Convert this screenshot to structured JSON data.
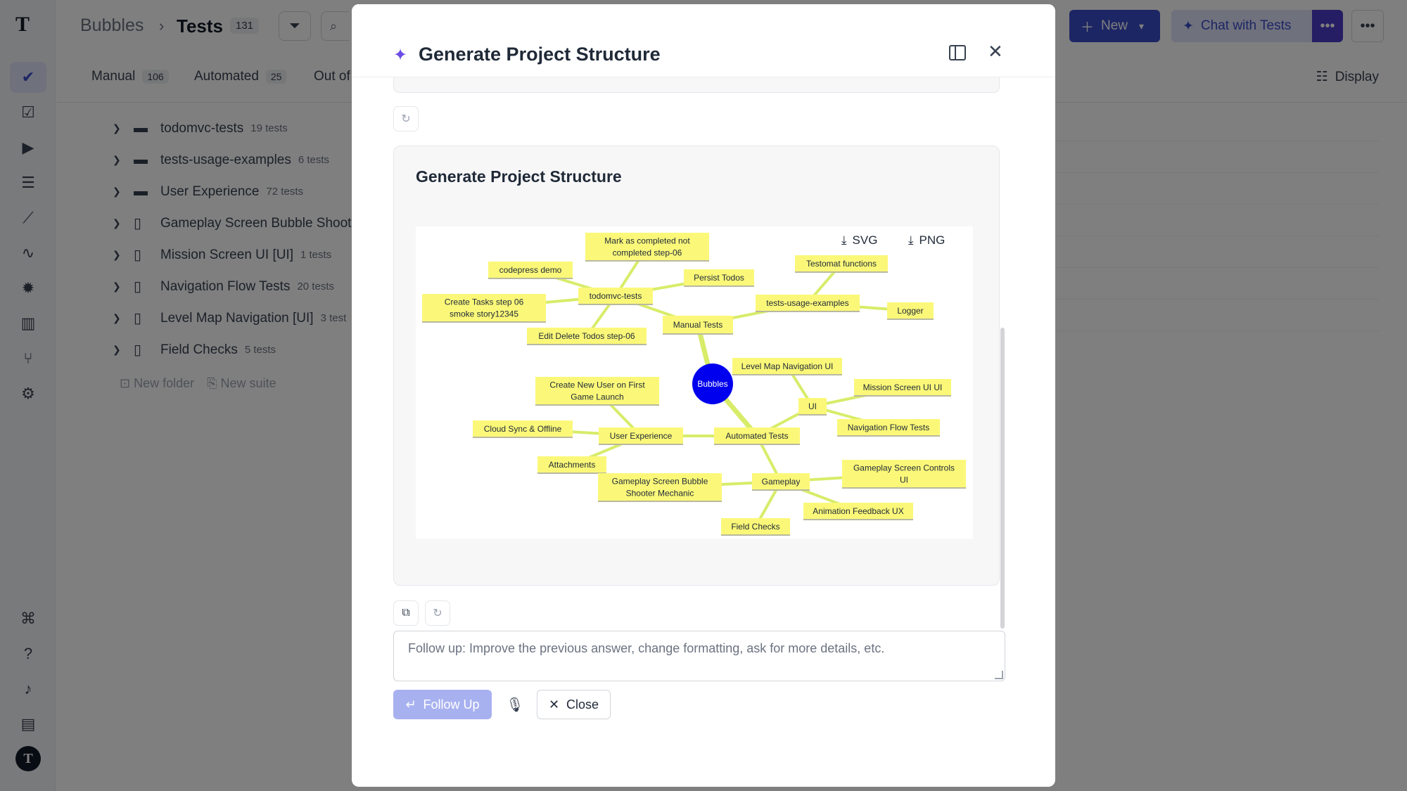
{
  "app": {
    "logo": "T",
    "avatar_letter": "T",
    "breadcrumb": {
      "root": "Bubbles",
      "separator": "›",
      "current": "Tests",
      "count": "131"
    },
    "buttons": {
      "new_label": "New",
      "chat_label": "Chat with Tests",
      "display_label": "Display"
    },
    "tabs": [
      {
        "label": "Manual",
        "count": "106"
      },
      {
        "label": "Automated",
        "count": "25"
      },
      {
        "label": "Out of",
        "count": ""
      }
    ],
    "tree": [
      {
        "name": "todomvc-tests",
        "count": "19 tests",
        "kind": "folder"
      },
      {
        "name": "tests-usage-examples",
        "count": "6 tests",
        "kind": "folder"
      },
      {
        "name": "User Experience",
        "count": "72 tests",
        "kind": "folder"
      },
      {
        "name": "Gameplay Screen Bubble Shoot",
        "count": "",
        "kind": "file"
      },
      {
        "name": "Mission Screen UI [UI]",
        "count": "1 tests",
        "kind": "file"
      },
      {
        "name": "Navigation Flow Tests",
        "count": "20 tests",
        "kind": "file"
      },
      {
        "name": "Level Map Navigation [UI]",
        "count": "3 test",
        "kind": "file"
      },
      {
        "name": "Field Checks",
        "count": "5 tests",
        "kind": "file"
      }
    ],
    "tree_actions": {
      "new_folder": "New folder",
      "new_suite": "New suite"
    }
  },
  "modal": {
    "title": "Generate Project Structure",
    "result_title": "Generate Project Structure",
    "download_svg": "SVG",
    "download_png": "PNG",
    "followup_placeholder": "Follow up: Improve the previous answer, change formatting, ask for more details, etc.",
    "followup_button": "Follow Up",
    "close_button": "Close"
  },
  "mindmap": {
    "root": "Bubbles",
    "colors": {
      "node": "#fbf879",
      "root": "#0000ee",
      "link": "#d8ec69"
    },
    "nodes": [
      {
        "id": "manual",
        "label": "Manual Tests",
        "parent": "root"
      },
      {
        "id": "todomvc",
        "label": "todomvc-tests",
        "parent": "manual"
      },
      {
        "id": "markcomp",
        "label": "Mark as completed not|completed step-06",
        "parent": "todomvc"
      },
      {
        "id": "codepress",
        "label": "codepress demo",
        "parent": "todomvc"
      },
      {
        "id": "persist",
        "label": "Persist Todos",
        "parent": "todomvc"
      },
      {
        "id": "createtasks",
        "label": "Create Tasks step 06|smoke story12345",
        "parent": "todomvc"
      },
      {
        "id": "editdelete",
        "label": "Edit Delete Todos step-06",
        "parent": "todomvc"
      },
      {
        "id": "usage",
        "label": "tests-usage-examples",
        "parent": "manual"
      },
      {
        "id": "testomat",
        "label": "Testomat functions",
        "parent": "usage"
      },
      {
        "id": "logger",
        "label": "Logger",
        "parent": "usage"
      },
      {
        "id": "automated",
        "label": "Automated Tests",
        "parent": "root"
      },
      {
        "id": "ui",
        "label": "UI",
        "parent": "automated"
      },
      {
        "id": "levelmap",
        "label": "Level Map Navigation UI",
        "parent": "ui"
      },
      {
        "id": "mission",
        "label": "Mission Screen UI UI",
        "parent": "ui"
      },
      {
        "id": "navflow",
        "label": "Navigation Flow Tests",
        "parent": "ui"
      },
      {
        "id": "ux",
        "label": "User Experience",
        "parent": "automated"
      },
      {
        "id": "createuser",
        "label": "Create New User on First|Game Launch",
        "parent": "ux"
      },
      {
        "id": "cloud",
        "label": "Cloud Sync & Offline",
        "parent": "ux"
      },
      {
        "id": "attach",
        "label": "Attachments",
        "parent": "ux"
      },
      {
        "id": "gameplay",
        "label": "Gameplay",
        "parent": "automated"
      },
      {
        "id": "gpcontrols",
        "label": "Gameplay Screen Controls|UI",
        "parent": "gameplay"
      },
      {
        "id": "gpbubble",
        "label": "Gameplay Screen Bubble|Shooter Mechanic",
        "parent": "gameplay"
      },
      {
        "id": "anim",
        "label": "Animation Feedback UX",
        "parent": "gameplay"
      },
      {
        "id": "field",
        "label": "Field Checks",
        "parent": "gameplay"
      }
    ]
  }
}
